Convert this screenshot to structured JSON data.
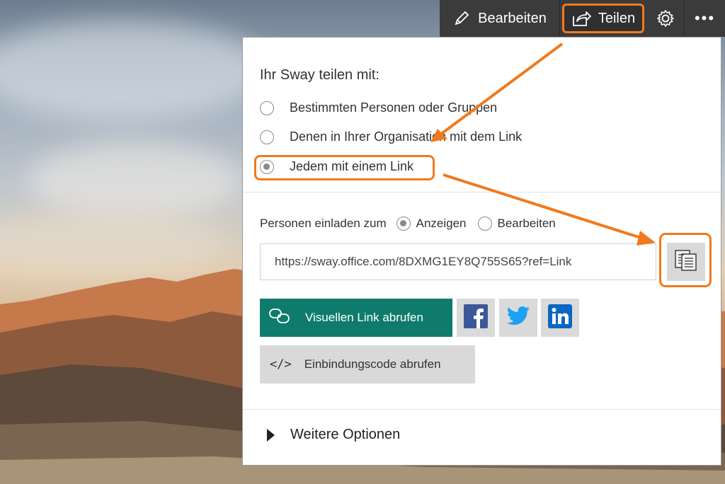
{
  "toolbar": {
    "edit_label": "Bearbeiten",
    "share_label": "Teilen",
    "edit_icon": "pencil-icon",
    "share_icon": "share-icon",
    "settings_icon": "gear-icon",
    "more_icon": "more-icon",
    "more_glyph": "•••"
  },
  "share_panel": {
    "heading": "Ihr Sway teilen mit:",
    "options": [
      {
        "label": "Bestimmten Personen oder Gruppen",
        "selected": false
      },
      {
        "label": "Denen in Ihrer Organisation mit dem Link",
        "selected": false
      },
      {
        "label": "Jedem mit einem Link",
        "selected": true
      }
    ],
    "invite_label": "Personen einladen zum",
    "invite_options": [
      {
        "label": "Anzeigen",
        "selected": true
      },
      {
        "label": "Bearbeiten",
        "selected": false
      }
    ],
    "link_value": "https://sway.office.com/8DXMG1EY8Q755S65?ref=Link",
    "copy_icon": "copy-icon",
    "visual_link_label": "Visuellen Link abrufen",
    "social": [
      "facebook-icon",
      "twitter-icon",
      "linkedin-icon"
    ],
    "embed_glyph": "</>",
    "embed_label": "Einbindungscode abrufen",
    "more_options_label": "Weitere Optionen"
  },
  "colors": {
    "accent_highlight": "#f07a1d",
    "visual_link_bg": "#0f7b6c",
    "toolbar_bg": "#3b3b3b",
    "facebook": "#3b5998",
    "twitter": "#1da1f2",
    "linkedin": "#0a66c2"
  }
}
